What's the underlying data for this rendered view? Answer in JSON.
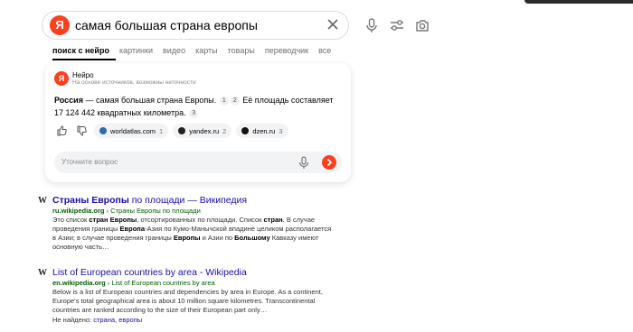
{
  "search": {
    "logo_letter": "Я",
    "query": "самая большая страна европы"
  },
  "tabs": [
    {
      "label": "поиск с нейро"
    },
    {
      "label": "картинки"
    },
    {
      "label": "видео"
    },
    {
      "label": "карты"
    },
    {
      "label": "товары"
    },
    {
      "label": "переводчик"
    },
    {
      "label": "все"
    }
  ],
  "neuro": {
    "title": "Нейро",
    "subtitle": "На основе источников, возможны неточности",
    "answer_strong": "Россия",
    "answer_part1": " — самая большая страна Европы.",
    "ref1": "1",
    "ref2": "2",
    "answer_part2": " Её площадь составляет 17 124 442 квадратных километра.",
    "ref3": "3",
    "sources": [
      {
        "name": "worldatlas.com",
        "count": "1",
        "color": "#2b6cb0"
      },
      {
        "name": "yandex.ru",
        "count": "2",
        "color": "#222222"
      },
      {
        "name": "dzen.ru",
        "count": "3",
        "color": "#111111"
      }
    ],
    "ask_placeholder": "Уточните вопрос"
  },
  "results": [
    {
      "favicon": "W",
      "title_strong": "Страны Европы",
      "title_rest": " по площади — Википедия",
      "url_strong": "ru.wikipedia.org",
      "url_rest": " › Страны Европы по площади",
      "snippet": [
        {
          "t": "Это список ",
          "b": false
        },
        {
          "t": "стран Европы",
          "b": true
        },
        {
          "t": ", отсортированных по площади. Список ",
          "b": false
        },
        {
          "t": "стран",
          "b": true
        },
        {
          "t": ". В случае проведения границы ",
          "b": false
        },
        {
          "t": "Европа",
          "b": true
        },
        {
          "t": "-Азия по Кумо-Манычской впадине целиком располагается в Азии; в случае проведения границы ",
          "b": false
        },
        {
          "t": "Европы",
          "b": true
        },
        {
          "t": " и Азии по ",
          "b": false
        },
        {
          "t": "Большому",
          "b": true
        },
        {
          "t": " Кавказу имеют основную часть…",
          "b": false
        }
      ]
    },
    {
      "favicon": "W",
      "title_strong": "",
      "title_rest": "List of European countries by area - Wikipedia",
      "url_strong": "en.wikipedia.org",
      "url_rest": " › List of European countries by area",
      "snippet": [
        {
          "t": "Below is a list of European countries and dependencies by area in Europe. As a continent, Europe's total geographical area is about 10 million square kilometres. Transcontinental countries are ranked according to the size of their European part only…",
          "b": false
        }
      ],
      "missing_label": "Не найдено: ",
      "missing_terms": "страна, европы"
    }
  ]
}
